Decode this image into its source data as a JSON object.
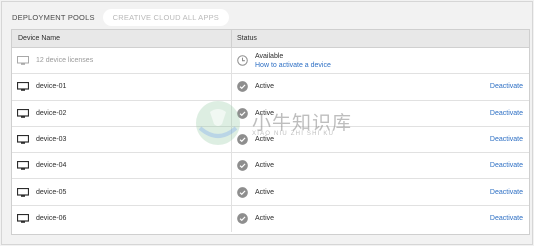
{
  "tabs": [
    "DEPLOYMENT POOLS",
    "CREATIVE CLOUD ALL APPS"
  ],
  "table": {
    "columns": [
      "Device Name",
      "Status"
    ],
    "summary_row": {
      "name": "12 device licenses",
      "status": "Available",
      "link": "How to activate a device"
    },
    "rows": [
      {
        "name": "device-01",
        "status": "Active",
        "action": "Deactivate"
      },
      {
        "name": "device-02",
        "status": "Active",
        "action": "Deactivate"
      },
      {
        "name": "device-03",
        "status": "Active",
        "action": "Deactivate"
      },
      {
        "name": "device-04",
        "status": "Active",
        "action": "Deactivate"
      },
      {
        "name": "device-05",
        "status": "Active",
        "action": "Deactivate"
      },
      {
        "name": "device-06",
        "status": "Active",
        "action": "Deactivate"
      }
    ]
  },
  "watermark": {
    "title": "小牛知识库",
    "subtitle": "XIAO NIU ZHI SHI KU"
  },
  "colors": {
    "link": "#2d6fc4",
    "header_bg": "#e8e8e8",
    "page_bg": "#f2f2f2"
  }
}
